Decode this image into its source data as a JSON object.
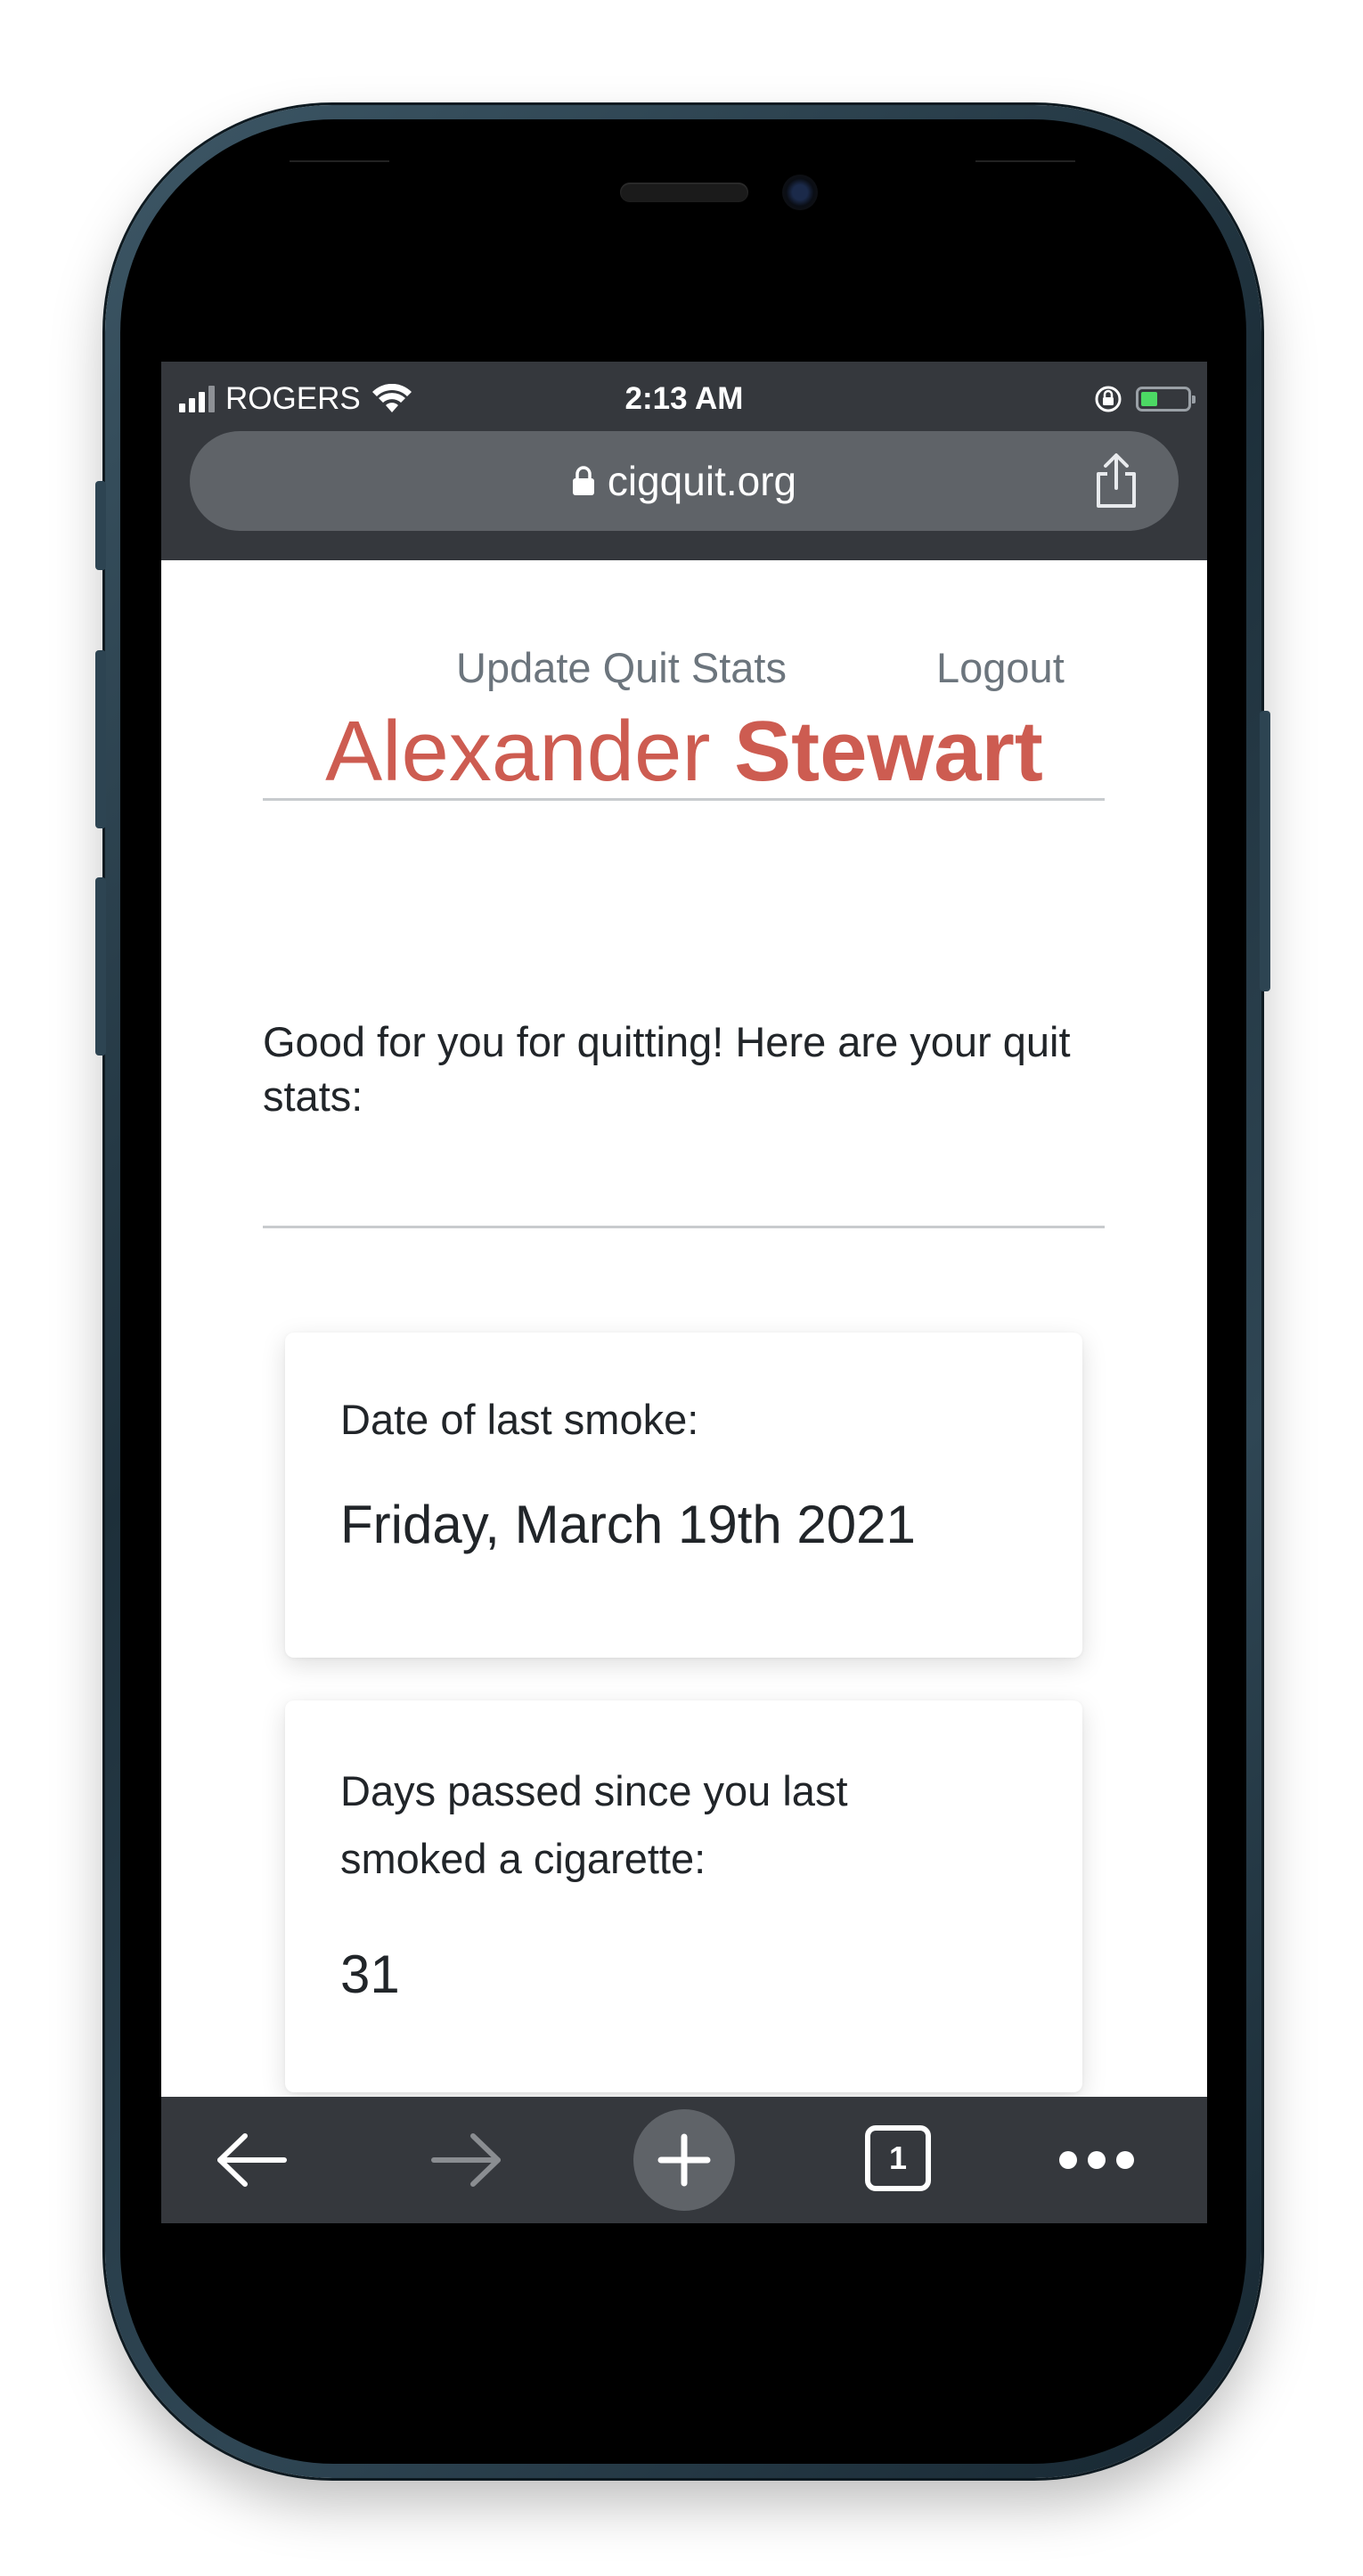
{
  "status_bar": {
    "carrier": "ROGERS",
    "time": "2:13 AM"
  },
  "browser": {
    "url": "cigquit.org",
    "tab_count": "1"
  },
  "nav": {
    "update_label": "Update Quit Stats",
    "logout_label": "Logout"
  },
  "profile": {
    "first_name": "Alexander",
    "last_name": "Stewart",
    "intro": "Good for you for quitting! Here are your quit stats:"
  },
  "stats": [
    {
      "label": "Date of last smoke:",
      "value": "Friday, March 19th 2021"
    },
    {
      "label": "Days passed since you last smoked a cigarette:",
      "value": "31"
    }
  ],
  "colors": {
    "accent": "#cd5c51",
    "chrome": "#35383d",
    "urlbar": "#5f6368"
  }
}
